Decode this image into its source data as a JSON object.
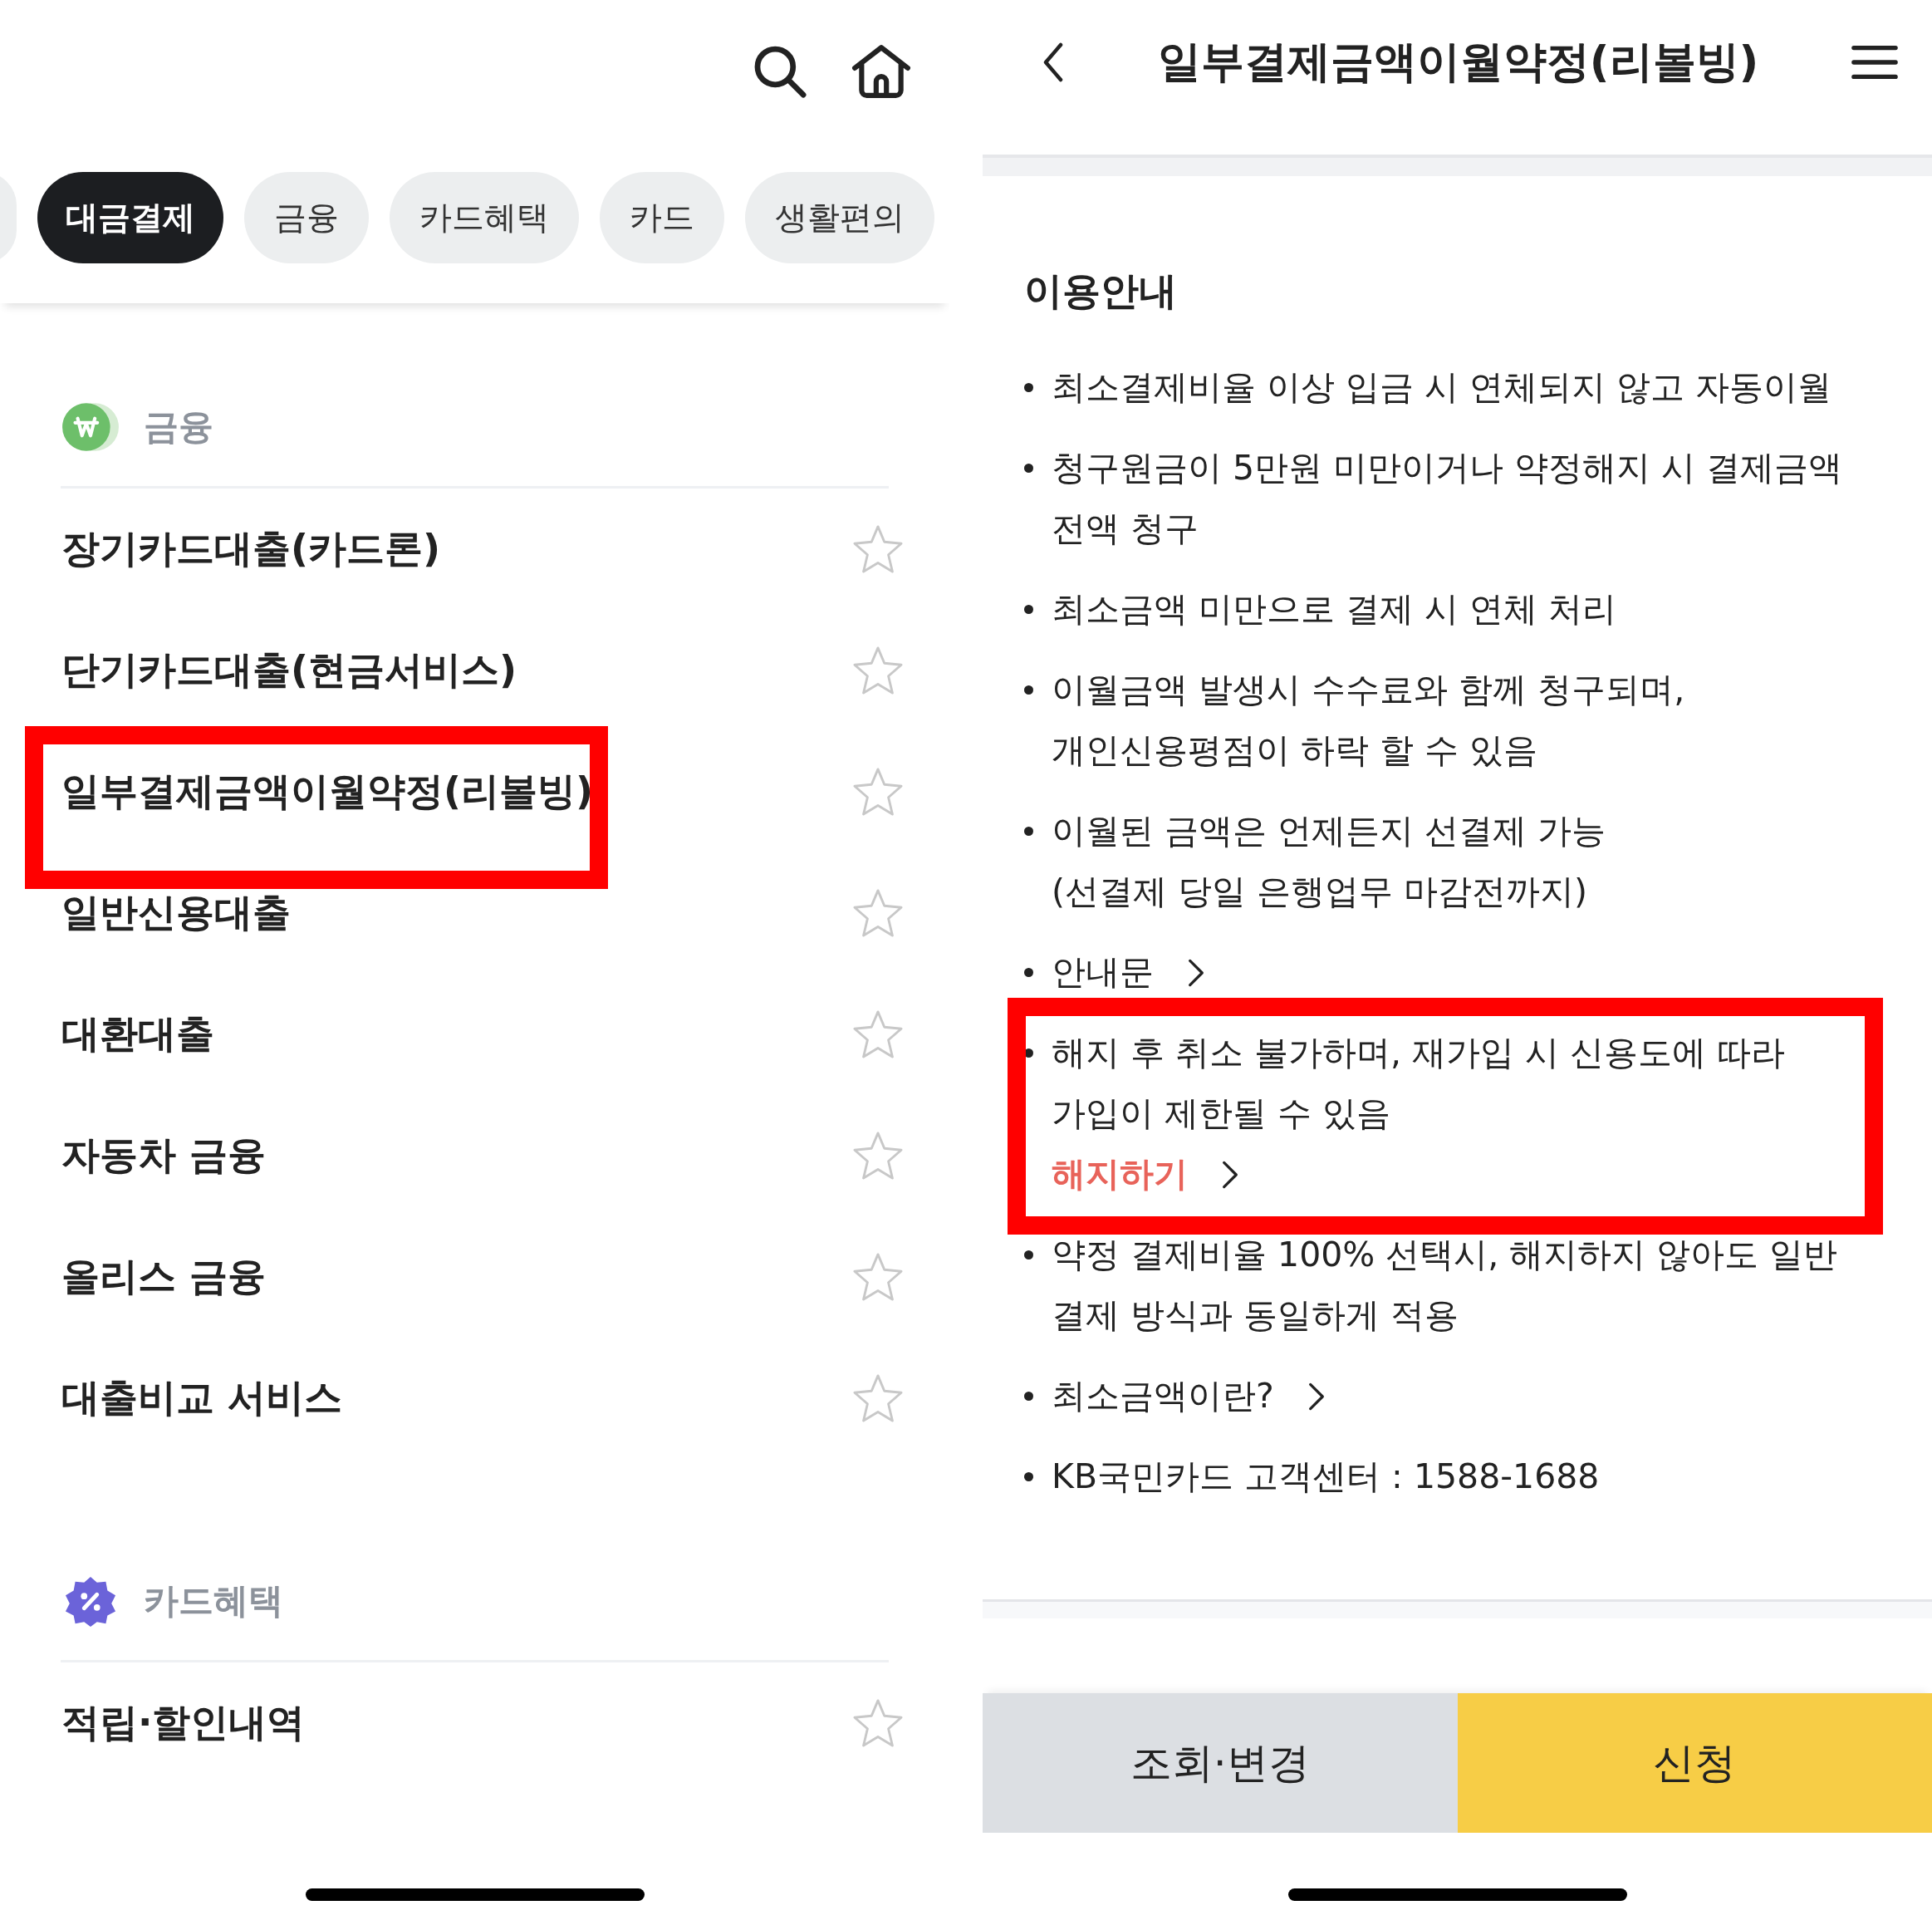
{
  "menu_screen": {
    "tabs": [
      {
        "label": "대금결제",
        "selected": true
      },
      {
        "label": "금융",
        "selected": false
      },
      {
        "label": "카드혜택",
        "selected": false
      },
      {
        "label": "카드",
        "selected": false
      },
      {
        "label": "생활편의",
        "selected": false
      }
    ],
    "sections": [
      {
        "title": "금융",
        "kind": "finance",
        "items": [
          {
            "label": "장기카드대출(카드론)",
            "favorite": false,
            "highlighted": false
          },
          {
            "label": "단기카드대출(현금서비스)",
            "favorite": false,
            "highlighted": false
          },
          {
            "label": "일부결제금액이월약정(리볼빙)",
            "favorite": false,
            "highlighted": true
          },
          {
            "label": "일반신용대출",
            "favorite": false,
            "highlighted": false
          },
          {
            "label": "대환대출",
            "favorite": false,
            "highlighted": false
          },
          {
            "label": "자동차 금융",
            "favorite": false,
            "highlighted": false
          },
          {
            "label": "올리스 금융",
            "favorite": false,
            "highlighted": false
          },
          {
            "label": "대출비교 서비스",
            "favorite": false,
            "highlighted": false
          }
        ]
      },
      {
        "title": "카드혜택",
        "kind": "benefit",
        "items": [
          {
            "label": "적립·할인내역",
            "favorite": false,
            "highlighted": false
          }
        ]
      }
    ]
  },
  "detail_screen": {
    "title": "일부결제금액이월약정(리볼빙)",
    "section_title": "이용안내",
    "notes": [
      {
        "kind": "text",
        "text": "최소결제비율 이상 입금 시 연체되지 않고 자동이월",
        "highlighted": false
      },
      {
        "kind": "text",
        "text": "청구원금이 5만원 미만이거나 약정해지 시 결제금액\n전액 청구",
        "highlighted": false
      },
      {
        "kind": "text",
        "text": "최소금액 미만으로 결제 시 연체 처리",
        "highlighted": false
      },
      {
        "kind": "text",
        "text": "이월금액 발생시 수수료와 함께 청구되며,\n개인신용평점이 하락 할 수 있음",
        "highlighted": false
      },
      {
        "kind": "text",
        "text": "이월된 금액은 언제든지 선결제 가능\n(선결제 당일 은행업무 마감전까지)",
        "highlighted": false
      },
      {
        "kind": "link",
        "text": "안내문",
        "highlighted": false
      },
      {
        "kind": "text",
        "text": "해지 후 취소 불가하며, 재가입 시 신용도에 따라\n가입이 제한될 수 있음",
        "action": "해지하기",
        "highlighted": true
      },
      {
        "kind": "text",
        "text": "약정 결제비율 100% 선택시, 해지하지 않아도 일반\n결제 방식과 동일하게 적용",
        "highlighted": false
      },
      {
        "kind": "link",
        "text": "최소금액이란?",
        "highlighted": false
      },
      {
        "kind": "text",
        "text": "KB국민카드 고객센터 : 1588-1688",
        "highlighted": false
      }
    ],
    "buttons": [
      {
        "label": "조회·변경",
        "kind": "secondary"
      },
      {
        "label": "신청",
        "kind": "primary"
      }
    ]
  }
}
